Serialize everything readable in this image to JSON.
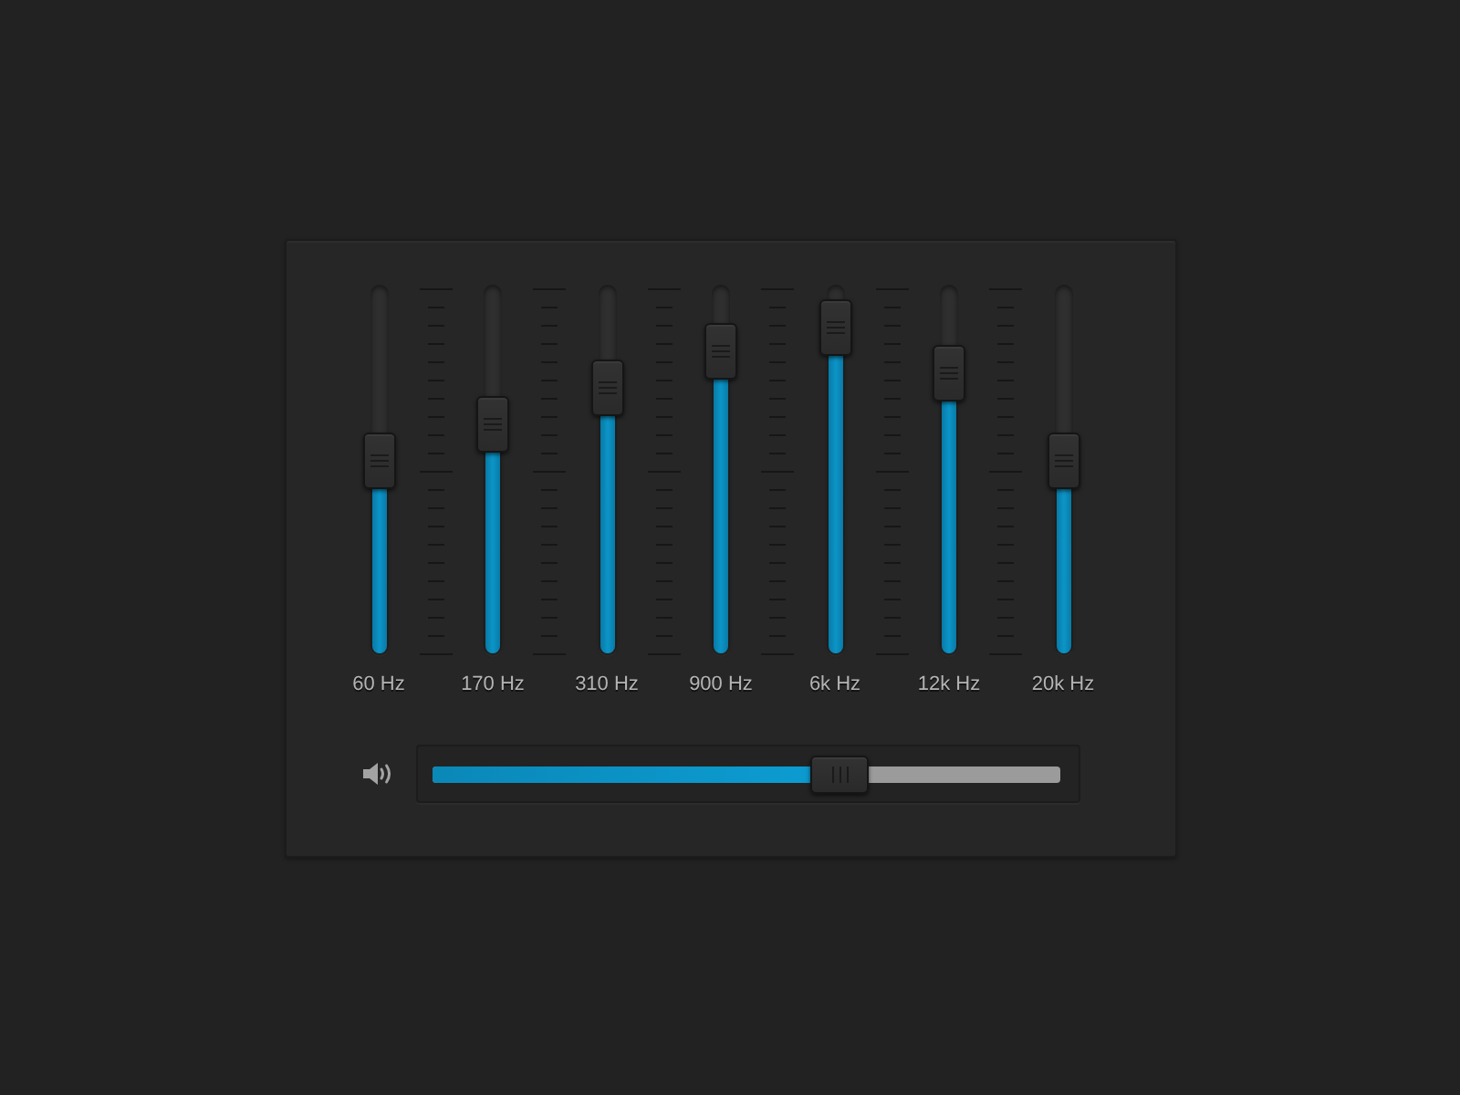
{
  "bands": [
    {
      "label": "60 Hz",
      "level": 0.52
    },
    {
      "label": "170 Hz",
      "level": 0.62
    },
    {
      "label": "310 Hz",
      "level": 0.72
    },
    {
      "label": "900 Hz",
      "level": 0.82
    },
    {
      "label": "6k Hz",
      "level": 0.88
    },
    {
      "label": "12k Hz",
      "level": 0.76
    },
    {
      "label": "20k Hz",
      "level": 0.52
    }
  ],
  "volume": {
    "level": 0.65
  }
}
